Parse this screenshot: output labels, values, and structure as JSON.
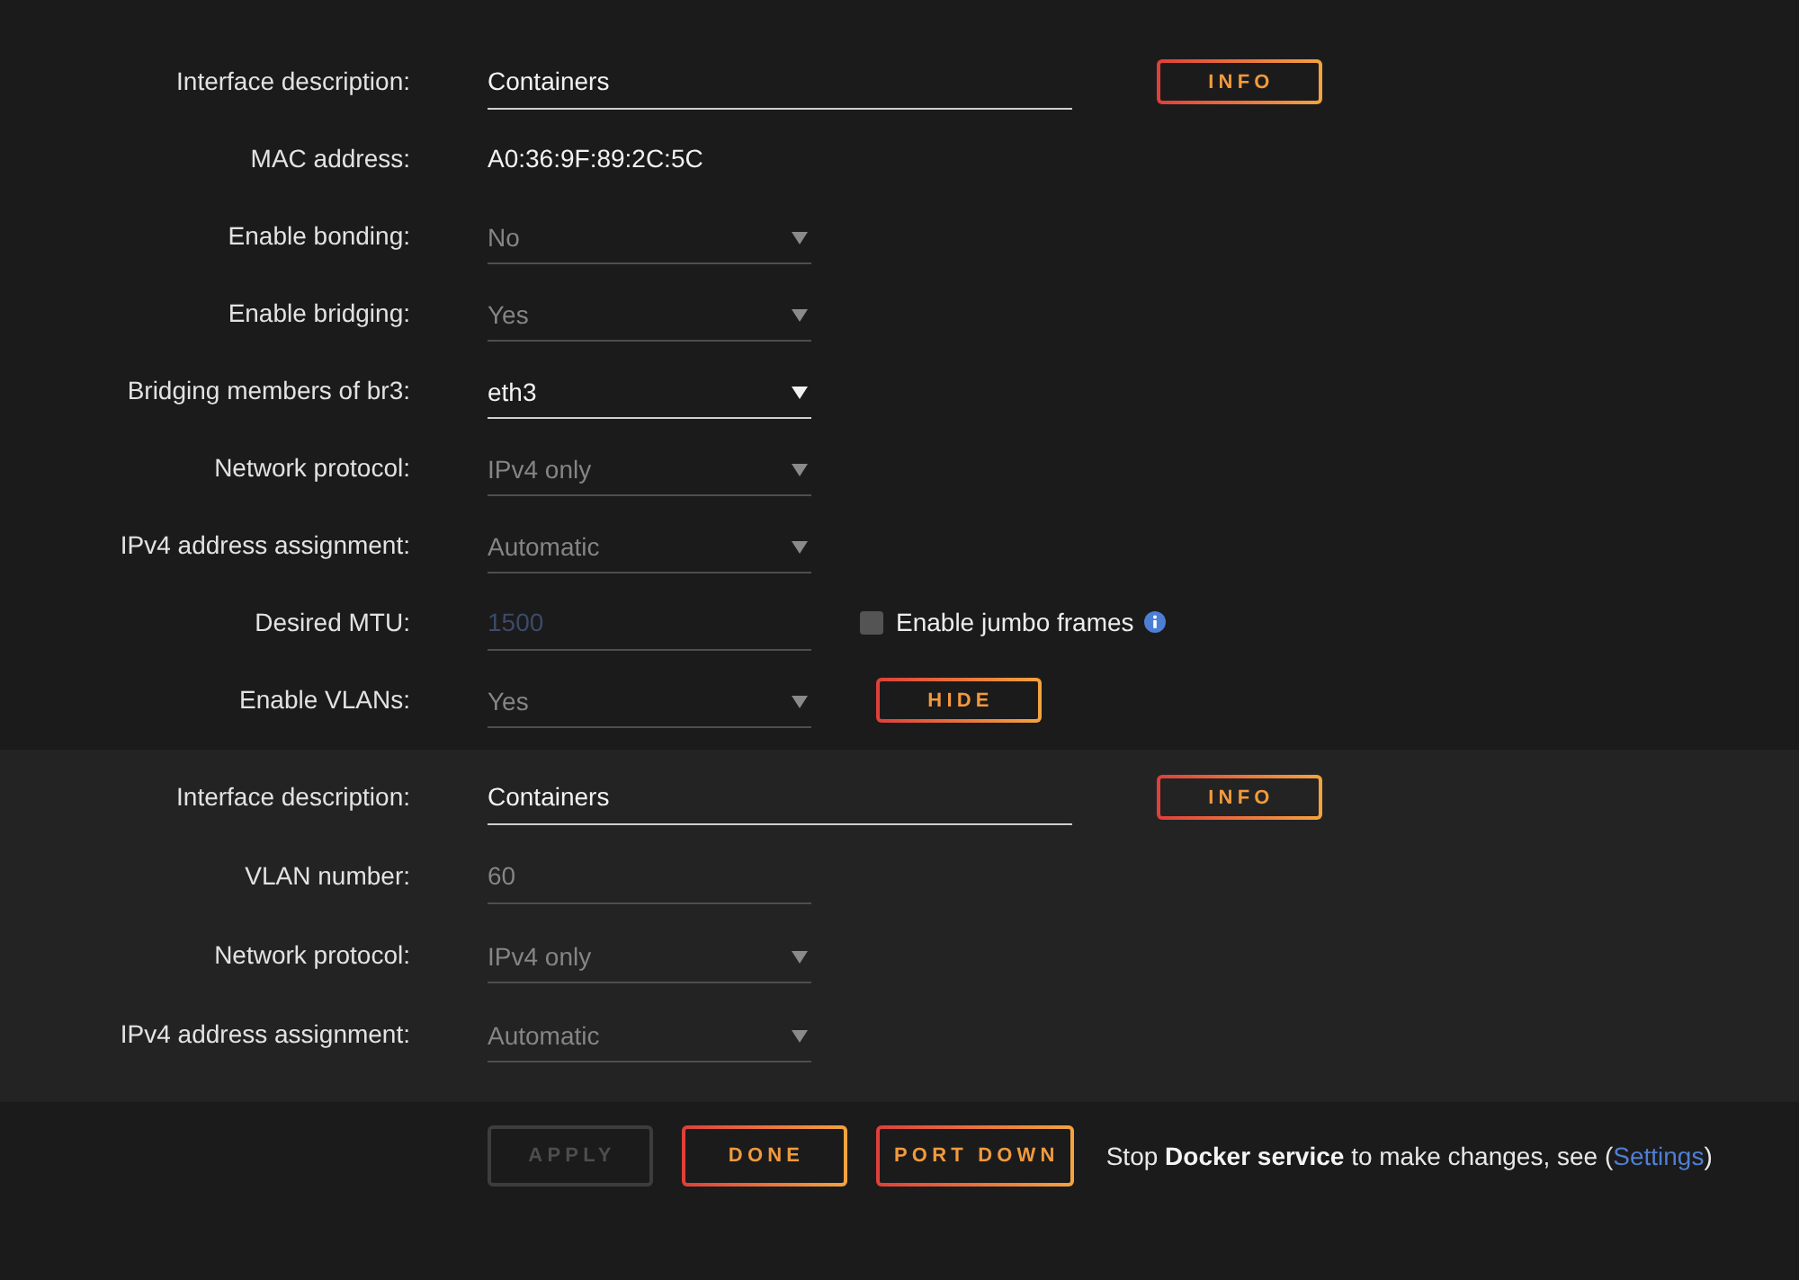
{
  "sections": [
    {
      "kind": "interface",
      "rows": [
        {
          "label": "Interface description:",
          "field": {
            "kind": "text",
            "value": "Containers",
            "disabled": false
          },
          "extra": {
            "kind": "button",
            "label": "INFO"
          }
        },
        {
          "label": "MAC address:",
          "field": {
            "kind": "static",
            "value": "A0:36:9F:89:2C:5C"
          }
        },
        {
          "label": "Enable bonding:",
          "field": {
            "kind": "select",
            "value": "No",
            "disabled": true
          }
        },
        {
          "label": "Enable bridging:",
          "field": {
            "kind": "select",
            "value": "Yes",
            "disabled": true
          }
        },
        {
          "label": "Bridging members of br3:",
          "field": {
            "kind": "select",
            "value": "eth3",
            "disabled": false
          }
        },
        {
          "label": "Network protocol:",
          "field": {
            "kind": "select",
            "value": "IPv4 only",
            "disabled": true
          }
        },
        {
          "label": "IPv4 address assignment:",
          "field": {
            "kind": "select",
            "value": "Automatic",
            "disabled": true
          }
        },
        {
          "label": "Desired MTU:",
          "field": {
            "kind": "number",
            "placeholder": "1500",
            "disabled": true
          },
          "extra": {
            "kind": "checkbox",
            "label": "Enable jumbo frames",
            "checked": false,
            "info_icon": true
          }
        },
        {
          "label": "Enable VLANs:",
          "field": {
            "kind": "select",
            "value": "Yes",
            "disabled": true
          },
          "extra": {
            "kind": "button",
            "label": "HIDE"
          }
        }
      ]
    },
    {
      "kind": "vlan",
      "rows": [
        {
          "label": "Interface description:",
          "field": {
            "kind": "text",
            "value": "Containers",
            "disabled": false
          },
          "extra": {
            "kind": "button",
            "label": "INFO"
          }
        },
        {
          "label": "VLAN number:",
          "field": {
            "kind": "number",
            "value": "60",
            "disabled": true
          }
        },
        {
          "label": "Network protocol:",
          "field": {
            "kind": "select",
            "value": "IPv4 only",
            "disabled": true
          }
        },
        {
          "label": "IPv4 address assignment:",
          "field": {
            "kind": "select",
            "value": "Automatic",
            "disabled": true
          }
        }
      ]
    }
  ],
  "footer": {
    "buttons": [
      {
        "label": "APPLY",
        "disabled": true
      },
      {
        "label": "DONE",
        "disabled": false
      },
      {
        "label": "PORT DOWN",
        "disabled": false
      }
    ],
    "message": "Stop **Docker service** to make changes, see (",
    "link": "Settings",
    "message_end": ")"
  }
}
